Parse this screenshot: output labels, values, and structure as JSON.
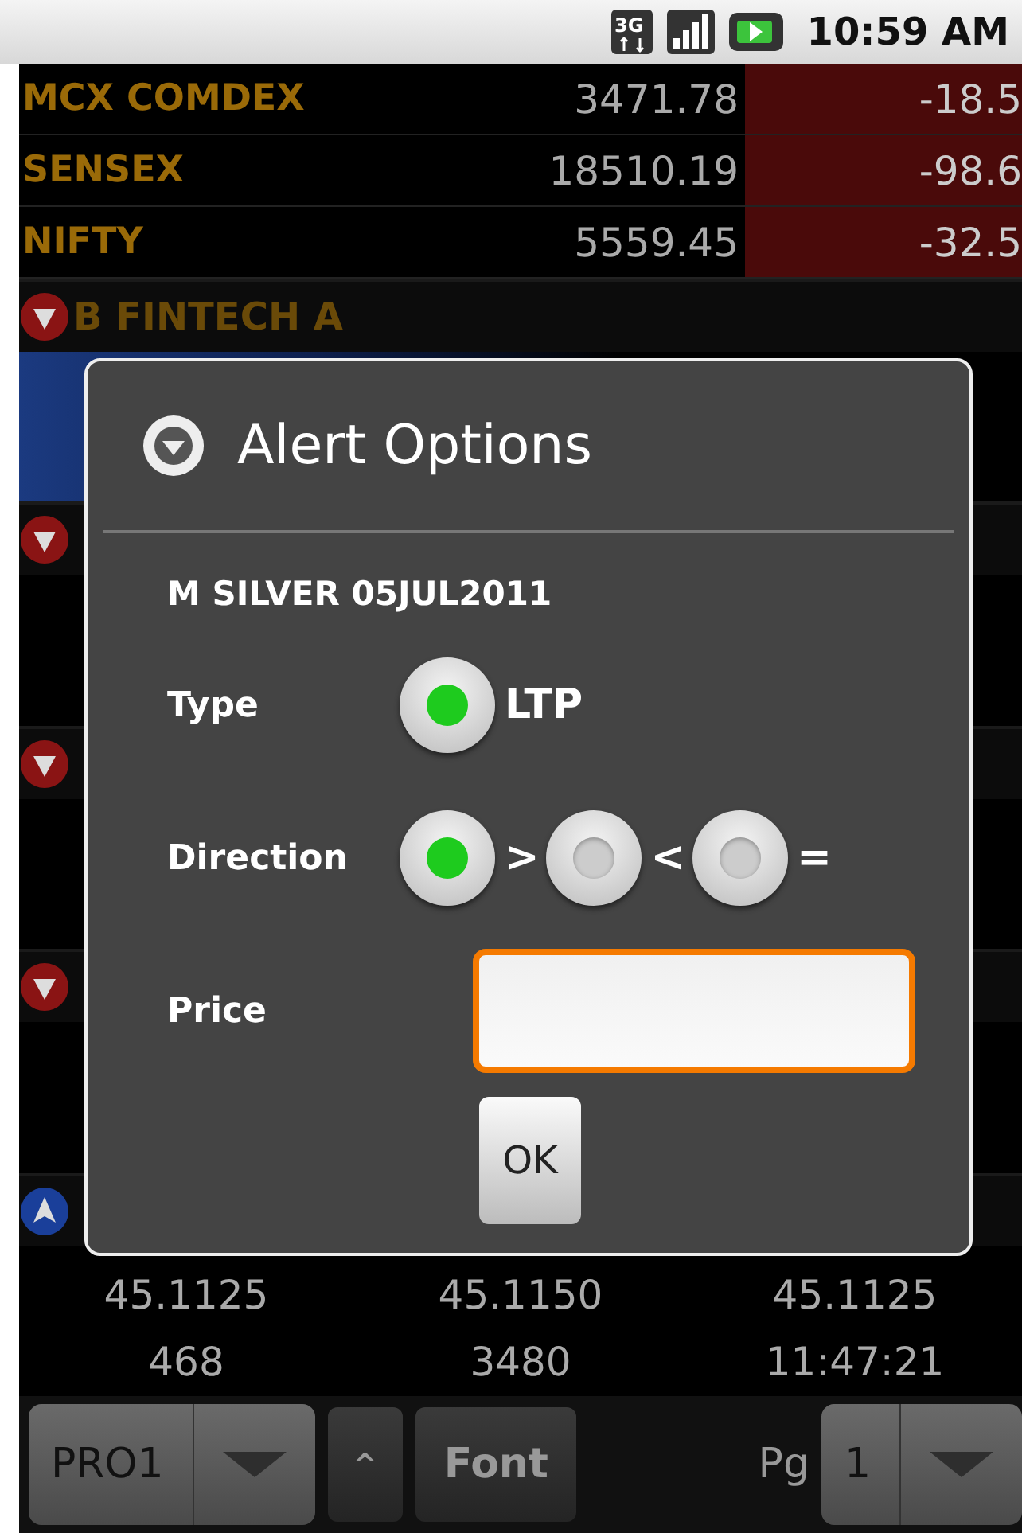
{
  "status_bar": {
    "network": "3G",
    "time": "10:59 AM"
  },
  "indices": [
    {
      "name": "MCX COMDEX",
      "value": "3471.78",
      "change": "-18.5"
    },
    {
      "name": "SENSEX",
      "value": "18510.19",
      "change": "-98.6"
    },
    {
      "name": "NIFTY",
      "value": "5559.45",
      "change": "-32.5"
    }
  ],
  "scrips": [
    {
      "name": "B FINTECH A",
      "kind": "down",
      "selected": true
    },
    {
      "kind": "down",
      "selected": false
    },
    {
      "kind": "down",
      "selected": false
    },
    {
      "kind": "down",
      "selected": false
    },
    {
      "kind": "up",
      "selected": false,
      "rows": [
        [
          "45.1125",
          "45.1150",
          "45.1125"
        ],
        [
          "468",
          "3480",
          "11:47:21"
        ]
      ]
    }
  ],
  "bottom_bar": {
    "profile": "PRO1",
    "up_button": "^",
    "font_button": "Font",
    "page_label": "Pg",
    "page": "1"
  },
  "dialog": {
    "title": "Alert Options",
    "scrip": "M SILVER 05JUL2011",
    "type": {
      "label": "Type",
      "options": [
        {
          "label": "LTP",
          "selected": true
        }
      ]
    },
    "direction": {
      "label": "Direction",
      "options": [
        {
          "label": ">",
          "selected": true
        },
        {
          "label": "<",
          "selected": false
        },
        {
          "label": "=",
          "selected": false
        }
      ]
    },
    "price": {
      "label": "Price"
    },
    "ok": "OK"
  }
}
